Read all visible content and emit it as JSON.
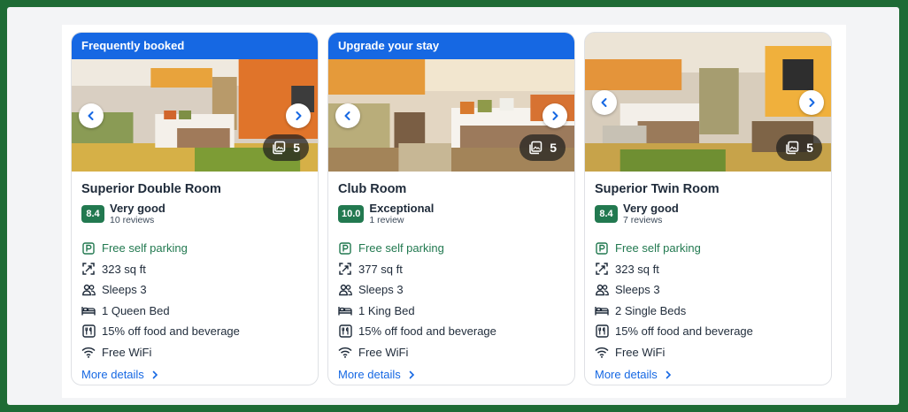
{
  "cards": [
    {
      "banner": "Frequently booked",
      "title": "Superior Double Room",
      "score": "8.4",
      "rating_label": "Very good",
      "reviews": "10 reviews",
      "photo_count": "5",
      "amenities": {
        "parking": "Free self parking",
        "size": "323 sq ft",
        "sleeps": "Sleeps 3",
        "bed": "1 Queen Bed",
        "food": "15% off food and beverage",
        "wifi": "Free WiFi"
      },
      "more_details": "More details"
    },
    {
      "banner": "Upgrade your stay",
      "title": "Club Room",
      "score": "10.0",
      "rating_label": "Exceptional",
      "reviews": "1 review",
      "photo_count": "5",
      "amenities": {
        "parking": "Free self parking",
        "size": "377 sq ft",
        "sleeps": "Sleeps 3",
        "bed": "1 King Bed",
        "food": "15% off food and beverage",
        "wifi": "Free WiFi"
      },
      "more_details": "More details"
    },
    {
      "banner": "",
      "title": "Superior Twin Room",
      "score": "8.4",
      "rating_label": "Very good",
      "reviews": "7 reviews",
      "photo_count": "5",
      "amenities": {
        "parking": "Free self parking",
        "size": "323 sq ft",
        "sleeps": "Sleeps 3",
        "bed": "2 Single Beds",
        "food": "15% off food and beverage",
        "wifi": "Free WiFi"
      },
      "more_details": "More details"
    }
  ],
  "colors": {
    "banner": "#1668e3",
    "score": "#227950",
    "link": "#1668e3",
    "parking_text": "#227950",
    "outer_border": "#1e6b35"
  },
  "icons": [
    "chevron-left-icon",
    "chevron-right-icon",
    "gallery-icon",
    "parking-icon",
    "area-icon",
    "people-icon",
    "bed-icon",
    "food-discount-icon",
    "wifi-icon"
  ]
}
